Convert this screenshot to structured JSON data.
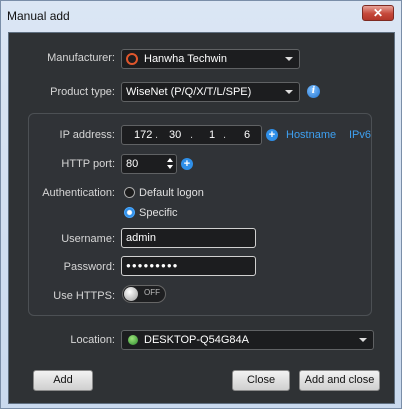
{
  "window": {
    "title": "Manual add",
    "close_glyph": "✕"
  },
  "manufacturer": {
    "label": "Manufacturer:",
    "value": "Hanwha Techwin",
    "icon": "hanwha-logo-icon"
  },
  "product_type": {
    "label": "Product type:",
    "value": "WiseNet (P/Q/X/T/L/SPE)",
    "info_glyph": "i"
  },
  "ip": {
    "label": "IP address:",
    "octets": [
      "172",
      "30",
      "1",
      "6"
    ],
    "hostname_link": "Hostname",
    "ipv6_link": "IPv6"
  },
  "http_port": {
    "label": "HTTP port:",
    "value": "80"
  },
  "authentication": {
    "label": "Authentication:",
    "options": [
      "Default logon",
      "Specific"
    ],
    "selected": "Specific"
  },
  "username": {
    "label": "Username:",
    "value": "admin"
  },
  "password": {
    "label": "Password:",
    "value": "●●●●●●●●●"
  },
  "use_https": {
    "label": "Use HTTPS:",
    "state": "OFF"
  },
  "location": {
    "label": "Location:",
    "value": "DESKTOP-Q54G84A"
  },
  "buttons": {
    "add": "Add",
    "close": "Close",
    "add_and_close": "Add and close"
  },
  "colors": {
    "dialog_bg": "#2f3235",
    "accent": "#2f8fe8",
    "link": "#3ea0f0"
  }
}
